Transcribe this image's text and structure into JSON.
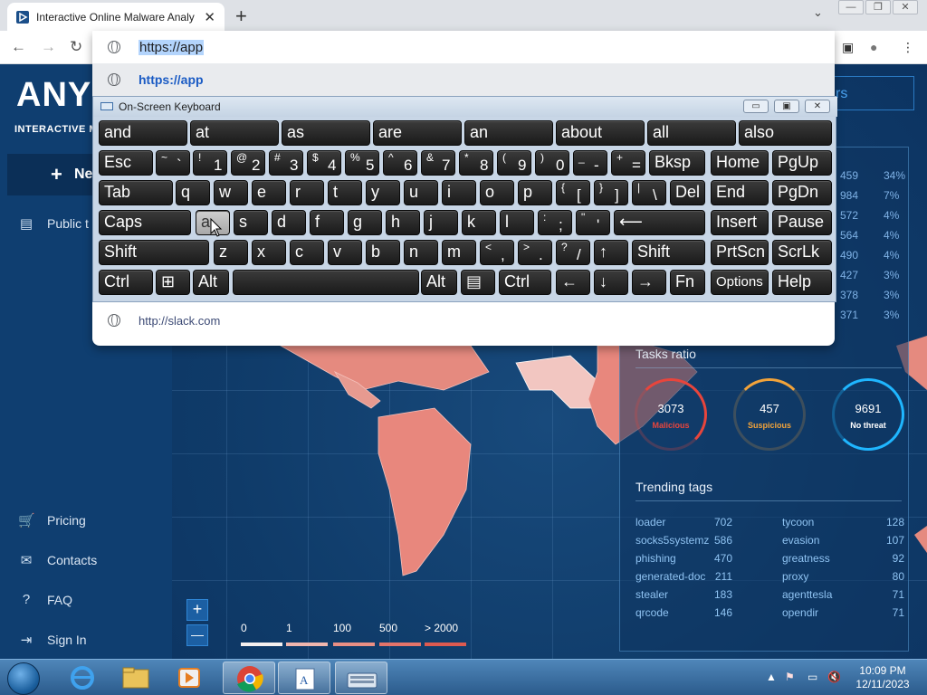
{
  "browser": {
    "tab_title": "Interactive Online Malware Analy",
    "tab_close": "✕",
    "new_tab": "+",
    "tab_search": "⌄",
    "window_buttons": [
      "—",
      "❐",
      "✕"
    ],
    "back": "←",
    "forward": "→",
    "reload": "↻",
    "omnibox_value": "https://app",
    "suggestions": [
      "https://app",
      "http://slack.com"
    ],
    "toolbar_icons": [
      "▣",
      "●",
      "⋮"
    ]
  },
  "app": {
    "logo": "ANY",
    "logo_sub": "INTERACTIVE MAL",
    "new_button": "New",
    "public_tasks": "Public t",
    "years_button": "rs",
    "sidebar_bottom": [
      "Pricing",
      "Contacts",
      "FAQ",
      "Sign In"
    ],
    "stats": [
      {
        "count": "459",
        "pct": "34%"
      },
      {
        "count": "984",
        "pct": "7%"
      },
      {
        "count": "572",
        "pct": "4%"
      },
      {
        "count": "564",
        "pct": "4%"
      },
      {
        "count": "490",
        "pct": "4%"
      },
      {
        "count": "427",
        "pct": "3%"
      },
      {
        "count": "378",
        "pct": "3%"
      },
      {
        "count": "371",
        "pct": "3%"
      }
    ],
    "tasks_ratio": {
      "title": "Tasks ratio",
      "malicious": {
        "value": "3073",
        "label": "Malicious",
        "color": "#e8453c"
      },
      "suspicious": {
        "value": "457",
        "label": "Suspicious",
        "color": "#f2a33a"
      },
      "no_threat": {
        "value": "9691",
        "label": "No threat",
        "color": "#1fb6ff"
      }
    },
    "trending": {
      "title": "Trending tags",
      "left": [
        {
          "tag": "loader",
          "count": "702"
        },
        {
          "tag": "socks5systemz",
          "count": "586"
        },
        {
          "tag": "phishing",
          "count": "470"
        },
        {
          "tag": "generated-doc",
          "count": "211"
        },
        {
          "tag": "stealer",
          "count": "183"
        },
        {
          "tag": "qrcode",
          "count": "146"
        }
      ],
      "right": [
        {
          "tag": "tycoon",
          "count": "128"
        },
        {
          "tag": "evasion",
          "count": "107"
        },
        {
          "tag": "greatness",
          "count": "92"
        },
        {
          "tag": "proxy",
          "count": "80"
        },
        {
          "tag": "agenttesla",
          "count": "71"
        },
        {
          "tag": "opendir",
          "count": "71"
        }
      ]
    },
    "zoom_in": "+",
    "zoom_out": "—",
    "legend": [
      "0",
      "1",
      "100",
      "500",
      "> 2000"
    ]
  },
  "osk": {
    "title": "On-Screen Keyboard",
    "ctl": [
      "▭",
      "▣",
      "✕"
    ],
    "row0": [
      "and",
      "at",
      "as",
      "are",
      "an",
      "about",
      "all",
      "also"
    ],
    "row1_esc": "Esc",
    "row1_keys": [
      {
        "sup": "~",
        "main": "`"
      },
      {
        "sup": "!",
        "main": "1"
      },
      {
        "sup": "@",
        "main": "2"
      },
      {
        "sup": "#",
        "main": "3"
      },
      {
        "sup": "$",
        "main": "4"
      },
      {
        "sup": "%",
        "main": "5"
      },
      {
        "sup": "^",
        "main": "6"
      },
      {
        "sup": "&",
        "main": "7"
      },
      {
        "sup": "*",
        "main": "8"
      },
      {
        "sup": "(",
        "main": "9"
      },
      {
        "sup": ")",
        "main": "0"
      },
      {
        "sup": "_",
        "main": "-"
      },
      {
        "sup": "+",
        "main": "="
      }
    ],
    "bksp": "Bksp",
    "home": "Home",
    "pgup": "PgUp",
    "tab": "Tab",
    "row2": [
      "q",
      "w",
      "e",
      "r",
      "t",
      "y",
      "u",
      "i",
      "o",
      "p"
    ],
    "row2_sym": [
      {
        "sup": "{",
        "main": "["
      },
      {
        "sup": "}",
        "main": "]"
      },
      {
        "sup": "|",
        "main": "\\"
      }
    ],
    "del": "Del",
    "end": "End",
    "pgdn": "PgDn",
    "caps": "Caps",
    "row3": [
      "a",
      "s",
      "d",
      "f",
      "g",
      "h",
      "j",
      "k",
      "l"
    ],
    "row3_sym": [
      {
        "sup": ":",
        "main": ";"
      },
      {
        "sup": "\"",
        "main": "'"
      }
    ],
    "enter": "⟵",
    "insert": "Insert",
    "pause": "Pause",
    "shift": "Shift",
    "row4": [
      "z",
      "x",
      "c",
      "v",
      "b",
      "n",
      "m"
    ],
    "row4_sym": [
      {
        "sup": "<",
        "main": ","
      },
      {
        "sup": ">",
        "main": "."
      },
      {
        "sup": "?",
        "main": "/"
      }
    ],
    "up": "↑",
    "shift_r": "Shift",
    "prtscn": "PrtScn",
    "scrlk": "ScrLk",
    "ctrl": "Ctrl",
    "win": "⊞",
    "alt": "Alt",
    "alt_r": "Alt",
    "menu": "▤",
    "ctrl_r": "Ctrl",
    "left": "←",
    "down": "↓",
    "right": "→",
    "fn": "Fn",
    "options": "Options",
    "help": "Help"
  },
  "taskbar": {
    "tray_icons": [
      "▲",
      "⚑",
      "▭",
      "🔇"
    ],
    "time": "10:09 PM",
    "date": "12/11/2023"
  }
}
